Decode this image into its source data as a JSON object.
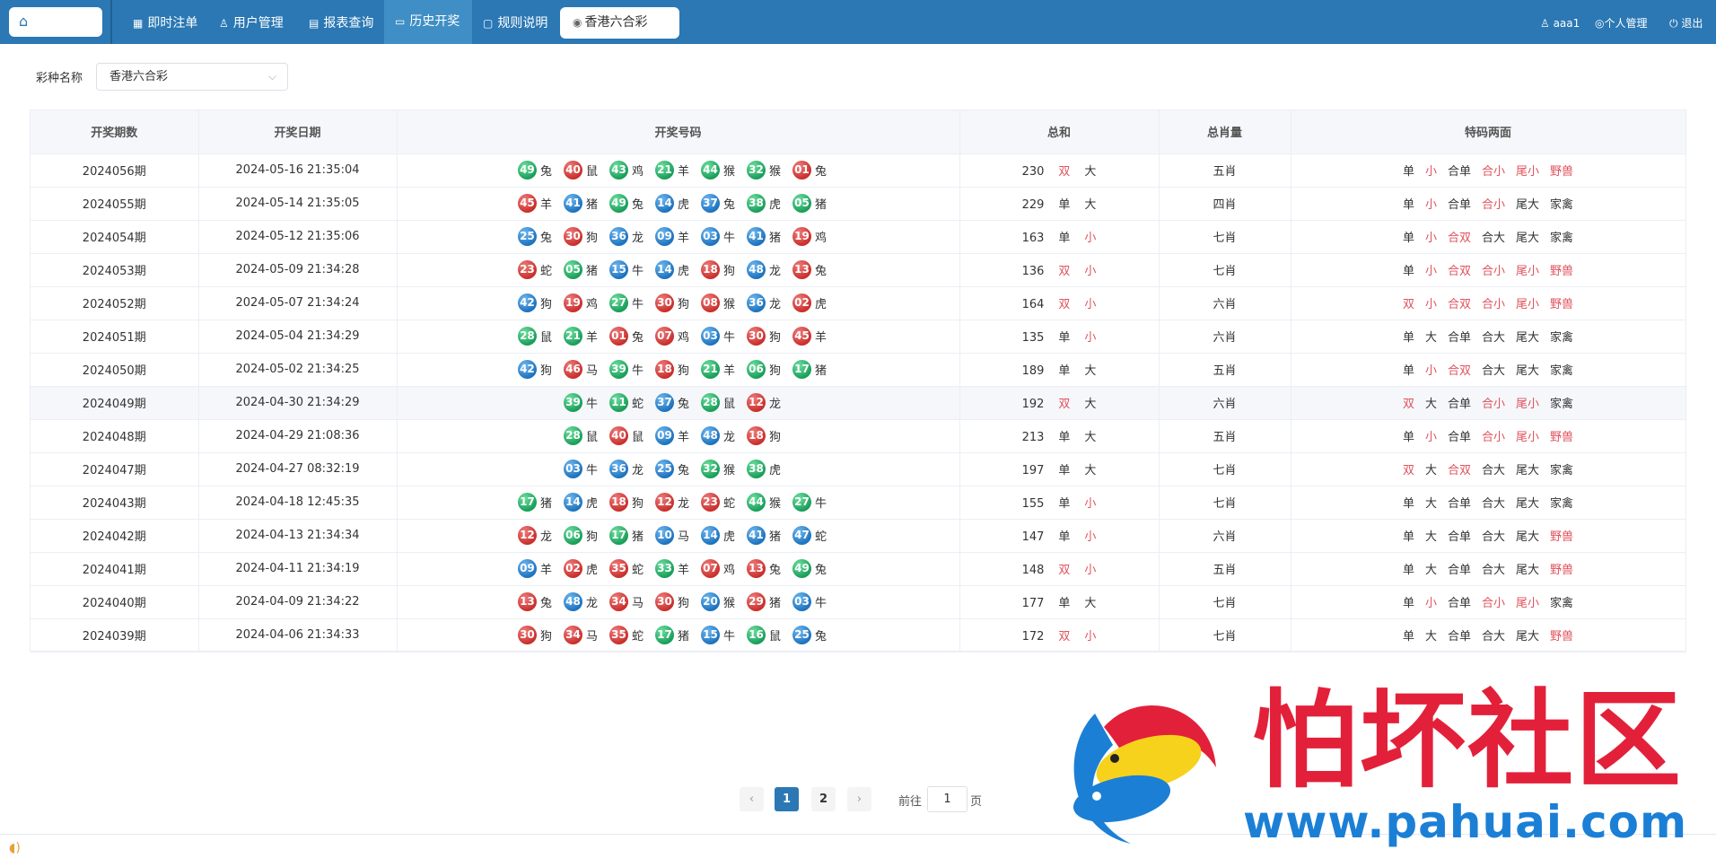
{
  "nav": {
    "items": [
      {
        "label": "即时注单",
        "icon": "grid-icon"
      },
      {
        "label": "用户管理",
        "icon": "user-icon"
      },
      {
        "label": "报表查询",
        "icon": "report-icon"
      },
      {
        "label": "历史开奖",
        "icon": "monitor-icon"
      },
      {
        "label": "规则说明",
        "icon": "chat-icon"
      }
    ],
    "tab": "香港六合彩",
    "user": "aaa1",
    "profile": "个人管理",
    "logout": "退出"
  },
  "filter": {
    "label": "彩种名称",
    "value": "香港六合彩"
  },
  "table": {
    "headers": [
      "开奖期数",
      "开奖日期",
      "开奖号码",
      "总和",
      "总肖量",
      "特码两面"
    ],
    "rows": [
      {
        "period": "2024056期",
        "date": "2024-05-16 21:35:04",
        "balls": [
          [
            "49",
            "兔",
            "green"
          ],
          [
            "40",
            "鼠",
            "red"
          ],
          [
            "43",
            "鸡",
            "green"
          ],
          [
            "21",
            "羊",
            "green"
          ],
          [
            "44",
            "猴",
            "green"
          ],
          [
            "32",
            "猴",
            "green"
          ],
          [
            "01",
            "兔",
            "red"
          ]
        ],
        "sum": "230",
        "oe": "双",
        "bs": "大",
        "zodiac": "五肖",
        "tm": [
          "单",
          "小",
          "合单",
          "合小",
          "尾小",
          "野兽"
        ]
      },
      {
        "period": "2024055期",
        "date": "2024-05-14 21:35:05",
        "balls": [
          [
            "45",
            "羊",
            "red"
          ],
          [
            "41",
            "猪",
            "blue"
          ],
          [
            "49",
            "兔",
            "green"
          ],
          [
            "14",
            "虎",
            "blue"
          ],
          [
            "37",
            "兔",
            "blue"
          ],
          [
            "38",
            "虎",
            "green"
          ],
          [
            "05",
            "猪",
            "green"
          ]
        ],
        "sum": "229",
        "oe": "单",
        "bs": "大",
        "zodiac": "四肖",
        "tm": [
          "单",
          "小",
          "合单",
          "合小",
          "尾大",
          "家禽"
        ]
      },
      {
        "period": "2024054期",
        "date": "2024-05-12 21:35:06",
        "balls": [
          [
            "25",
            "兔",
            "blue"
          ],
          [
            "30",
            "狗",
            "red"
          ],
          [
            "36",
            "龙",
            "blue"
          ],
          [
            "09",
            "羊",
            "blue"
          ],
          [
            "03",
            "牛",
            "blue"
          ],
          [
            "41",
            "猪",
            "blue"
          ],
          [
            "19",
            "鸡",
            "red"
          ]
        ],
        "sum": "163",
        "oe": "单",
        "bs": "小",
        "zodiac": "七肖",
        "tm": [
          "单",
          "小",
          "合双",
          "合大",
          "尾大",
          "家禽"
        ]
      },
      {
        "period": "2024053期",
        "date": "2024-05-09 21:34:28",
        "balls": [
          [
            "23",
            "蛇",
            "red"
          ],
          [
            "05",
            "猪",
            "green"
          ],
          [
            "15",
            "牛",
            "blue"
          ],
          [
            "14",
            "虎",
            "blue"
          ],
          [
            "18",
            "狗",
            "red"
          ],
          [
            "48",
            "龙",
            "blue"
          ],
          [
            "13",
            "兔",
            "red"
          ]
        ],
        "sum": "136",
        "oe": "双",
        "bs": "小",
        "zodiac": "七肖",
        "tm": [
          "单",
          "小",
          "合双",
          "合小",
          "尾小",
          "野兽"
        ]
      },
      {
        "period": "2024052期",
        "date": "2024-05-07 21:34:24",
        "balls": [
          [
            "42",
            "狗",
            "blue"
          ],
          [
            "19",
            "鸡",
            "red"
          ],
          [
            "27",
            "牛",
            "green"
          ],
          [
            "30",
            "狗",
            "red"
          ],
          [
            "08",
            "猴",
            "red"
          ],
          [
            "36",
            "龙",
            "blue"
          ],
          [
            "02",
            "虎",
            "red"
          ]
        ],
        "sum": "164",
        "oe": "双",
        "bs": "小",
        "zodiac": "六肖",
        "tm": [
          "双",
          "小",
          "合双",
          "合小",
          "尾小",
          "野兽"
        ]
      },
      {
        "period": "2024051期",
        "date": "2024-05-04 21:34:29",
        "balls": [
          [
            "28",
            "鼠",
            "green"
          ],
          [
            "21",
            "羊",
            "green"
          ],
          [
            "01",
            "兔",
            "red"
          ],
          [
            "07",
            "鸡",
            "red"
          ],
          [
            "03",
            "牛",
            "blue"
          ],
          [
            "30",
            "狗",
            "red"
          ],
          [
            "45",
            "羊",
            "red"
          ]
        ],
        "sum": "135",
        "oe": "单",
        "bs": "小",
        "zodiac": "六肖",
        "tm": [
          "单",
          "大",
          "合单",
          "合大",
          "尾大",
          "家禽"
        ]
      },
      {
        "period": "2024050期",
        "date": "2024-05-02 21:34:25",
        "balls": [
          [
            "42",
            "狗",
            "blue"
          ],
          [
            "46",
            "马",
            "red"
          ],
          [
            "39",
            "牛",
            "green"
          ],
          [
            "18",
            "狗",
            "red"
          ],
          [
            "21",
            "羊",
            "green"
          ],
          [
            "06",
            "狗",
            "green"
          ],
          [
            "17",
            "猪",
            "green"
          ]
        ],
        "sum": "189",
        "oe": "单",
        "bs": "大",
        "zodiac": "五肖",
        "tm": [
          "单",
          "小",
          "合双",
          "合大",
          "尾大",
          "家禽"
        ]
      },
      {
        "period": "2024049期",
        "date": "2024-04-30 21:34:29",
        "balls": [
          [
            "39",
            "牛",
            "green"
          ],
          [
            "11",
            "蛇",
            "green"
          ],
          [
            "37",
            "兔",
            "blue"
          ],
          [
            "28",
            "鼠",
            "green"
          ],
          [
            "12",
            "龙",
            "red"
          ]
        ],
        "sum": "192",
        "oe": "双",
        "bs": "大",
        "zodiac": "六肖",
        "tm": [
          "双",
          "大",
          "合单",
          "合小",
          "尾小",
          "家禽"
        ]
      },
      {
        "period": "2024048期",
        "date": "2024-04-29 21:08:36",
        "balls": [
          [
            "28",
            "鼠",
            "green"
          ],
          [
            "40",
            "鼠",
            "red"
          ],
          [
            "09",
            "羊",
            "blue"
          ],
          [
            "48",
            "龙",
            "blue"
          ],
          [
            "18",
            "狗",
            "red"
          ]
        ],
        "sum": "213",
        "oe": "单",
        "bs": "大",
        "zodiac": "五肖",
        "tm": [
          "单",
          "小",
          "合单",
          "合小",
          "尾小",
          "野兽"
        ]
      },
      {
        "period": "2024047期",
        "date": "2024-04-27 08:32:19",
        "balls": [
          [
            "03",
            "牛",
            "blue"
          ],
          [
            "36",
            "龙",
            "blue"
          ],
          [
            "25",
            "兔",
            "blue"
          ],
          [
            "32",
            "猴",
            "green"
          ],
          [
            "38",
            "虎",
            "green"
          ]
        ],
        "sum": "197",
        "oe": "单",
        "bs": "大",
        "zodiac": "七肖",
        "tm": [
          "双",
          "大",
          "合双",
          "合大",
          "尾大",
          "家禽"
        ]
      },
      {
        "period": "2024043期",
        "date": "2024-04-18 12:45:35",
        "balls": [
          [
            "17",
            "猪",
            "green"
          ],
          [
            "14",
            "虎",
            "blue"
          ],
          [
            "18",
            "狗",
            "red"
          ],
          [
            "12",
            "龙",
            "red"
          ],
          [
            "23",
            "蛇",
            "red"
          ],
          [
            "44",
            "猴",
            "green"
          ],
          [
            "27",
            "牛",
            "green"
          ]
        ],
        "sum": "155",
        "oe": "单",
        "bs": "小",
        "zodiac": "七肖",
        "tm": [
          "单",
          "大",
          "合单",
          "合大",
          "尾大",
          "家禽"
        ]
      },
      {
        "period": "2024042期",
        "date": "2024-04-13 21:34:34",
        "balls": [
          [
            "12",
            "龙",
            "red"
          ],
          [
            "06",
            "狗",
            "green"
          ],
          [
            "17",
            "猪",
            "green"
          ],
          [
            "10",
            "马",
            "blue"
          ],
          [
            "14",
            "虎",
            "blue"
          ],
          [
            "41",
            "猪",
            "blue"
          ],
          [
            "47",
            "蛇",
            "blue"
          ]
        ],
        "sum": "147",
        "oe": "单",
        "bs": "小",
        "zodiac": "六肖",
        "tm": [
          "单",
          "大",
          "合单",
          "合大",
          "尾大",
          "野兽"
        ]
      },
      {
        "period": "2024041期",
        "date": "2024-04-11 21:34:19",
        "balls": [
          [
            "09",
            "羊",
            "blue"
          ],
          [
            "02",
            "虎",
            "red"
          ],
          [
            "35",
            "蛇",
            "red"
          ],
          [
            "33",
            "羊",
            "green"
          ],
          [
            "07",
            "鸡",
            "red"
          ],
          [
            "13",
            "兔",
            "red"
          ],
          [
            "49",
            "兔",
            "green"
          ]
        ],
        "sum": "148",
        "oe": "双",
        "bs": "小",
        "zodiac": "五肖",
        "tm": [
          "单",
          "大",
          "合单",
          "合大",
          "尾大",
          "野兽"
        ]
      },
      {
        "period": "2024040期",
        "date": "2024-04-09 21:34:22",
        "balls": [
          [
            "13",
            "兔",
            "red"
          ],
          [
            "48",
            "龙",
            "blue"
          ],
          [
            "34",
            "马",
            "red"
          ],
          [
            "30",
            "狗",
            "red"
          ],
          [
            "20",
            "猴",
            "blue"
          ],
          [
            "29",
            "猪",
            "red"
          ],
          [
            "03",
            "牛",
            "blue"
          ]
        ],
        "sum": "177",
        "oe": "单",
        "bs": "大",
        "zodiac": "七肖",
        "tm": [
          "单",
          "小",
          "合单",
          "合小",
          "尾小",
          "家禽"
        ]
      },
      {
        "period": "2024039期",
        "date": "2024-04-06 21:34:33",
        "balls": [
          [
            "30",
            "狗",
            "red"
          ],
          [
            "34",
            "马",
            "red"
          ],
          [
            "35",
            "蛇",
            "red"
          ],
          [
            "17",
            "猪",
            "green"
          ],
          [
            "15",
            "牛",
            "blue"
          ],
          [
            "16",
            "鼠",
            "green"
          ],
          [
            "25",
            "兔",
            "blue"
          ]
        ],
        "sum": "172",
        "oe": "双",
        "bs": "小",
        "zodiac": "七肖",
        "tm": [
          "单",
          "大",
          "合单",
          "合大",
          "尾大",
          "野兽"
        ]
      }
    ]
  },
  "pagination": {
    "prev": "‹",
    "pages": [
      "1",
      "2"
    ],
    "next": "›",
    "goto_label": "前往",
    "goto_value": "1",
    "page_suffix": "页"
  },
  "watermark": {
    "cn": "怕坏社区",
    "url": "www.pahuai.com"
  },
  "colors": {
    "primary": "#2b78b4",
    "red": "#e0525c"
  }
}
